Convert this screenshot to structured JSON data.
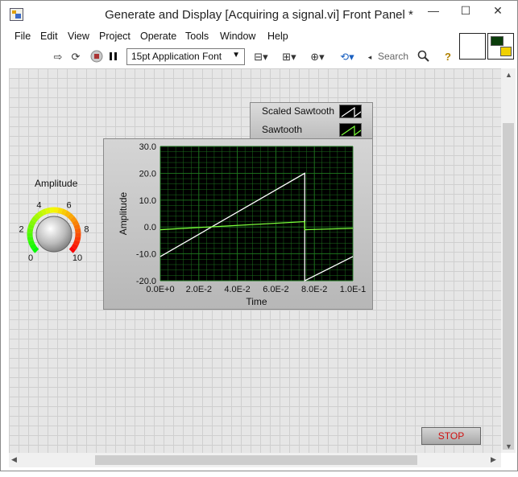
{
  "window": {
    "title": "Generate and Display [Acquiring a signal.vi] Front Panel *",
    "controls": {
      "minimize": "—",
      "maximize": "☐",
      "close": "✕"
    }
  },
  "menu": [
    "File",
    "Edit",
    "View",
    "Project",
    "Operate",
    "Tools",
    "Window",
    "Help"
  ],
  "toolbar": {
    "font": "15pt Application Font",
    "search_placeholder": "Search",
    "icons": [
      "run-arrow-icon",
      "run-continuous-icon",
      "abort-icon",
      "pause-icon",
      "align-icon",
      "distribute-icon",
      "resize-icon",
      "reorder-icon",
      "search-icon",
      "help-icon"
    ]
  },
  "knob": {
    "label": "Amplitude",
    "ticks": [
      "0",
      "2",
      "4",
      "6",
      "8",
      "10"
    ],
    "min": 0,
    "max": 10,
    "value": 5
  },
  "legend": [
    {
      "name": "Scaled Sawtooth",
      "color": "#ffffff"
    },
    {
      "name": "Sawtooth",
      "color": "#7cff3a"
    }
  ],
  "chart_data": {
    "type": "line",
    "xlabel": "Time",
    "ylabel": "Amplitude",
    "xlim": [
      0,
      0.1
    ],
    "ylim": [
      -20,
      30
    ],
    "x_ticks": [
      "0.0E+0",
      "2.0E-2",
      "4.0E-2",
      "6.0E-2",
      "8.0E-2",
      "1.0E-1"
    ],
    "y_ticks": [
      "30.0",
      "20.0",
      "10.0",
      "0.0",
      "-10.0",
      "-20.0"
    ],
    "grid": true,
    "series": [
      {
        "name": "Scaled Sawtooth",
        "color": "#ffffff",
        "x": [
          0,
          0.075,
          0.075,
          0.1
        ],
        "y": [
          -11,
          20,
          -20,
          -11
        ]
      },
      {
        "name": "Sawtooth",
        "color": "#7cff3a",
        "x": [
          0,
          0.075,
          0.075,
          0.1
        ],
        "y": [
          -1,
          2,
          -1,
          -0.5
        ]
      }
    ]
  },
  "stop_button": {
    "label": "STOP"
  },
  "colors": {
    "plot_bg": "#000000",
    "grid": "#1f7a1f",
    "stop_text": "#d01010"
  }
}
